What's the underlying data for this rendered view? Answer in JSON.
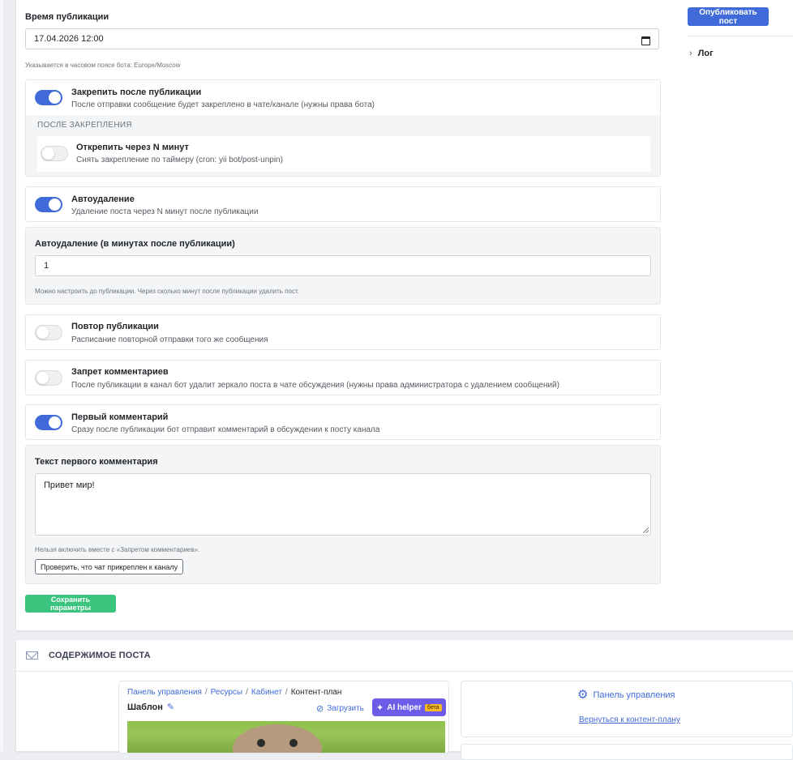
{
  "sidebar": {
    "publish_label": "Опубликовать пост",
    "log_label": "Лог"
  },
  "schedule": {
    "label": "Время публикации",
    "datetime_value": "17.04.2026 12:00",
    "hint": "Указывается в часовом поясе бота: Europe/Moscow"
  },
  "pin": {
    "title": "Закрепить после публикации",
    "desc": "После отправки сообщение будет закреплено в чате/канале (нужны права бота)",
    "enabled": true,
    "after_label": "ПОСЛЕ ЗАКРЕПЛЕНИЯ",
    "unpin_title": "Открепить через N минут",
    "unpin_desc": "Снять закрепление по таймеру (cron: yii bot/post-unpin)",
    "unpin_enabled": false
  },
  "autodelete": {
    "title": "Автоудаление",
    "desc": "Удаление поста через N минут после публикации",
    "enabled": true,
    "minutes_label": "Автоудаление (в минутах после публикации)",
    "minutes_value": "1",
    "minutes_hint": "Можно настроить до публикации. Через сколько минут после публикации удалить пост."
  },
  "repeat": {
    "title": "Повтор публикации",
    "desc": "Расписание повторной отправки того же сообщения",
    "enabled": false
  },
  "no_comments": {
    "title": "Запрет комментариев",
    "desc": "После публикации в канал бот удалит зеркало поста в чате обсуждения (нужны права администратора с удалением сообщений)",
    "enabled": false
  },
  "first_comment": {
    "title": "Первый комментарий",
    "desc": "Сразу после публикации бот отправит комментарий в обсуждении к посту канала",
    "enabled": true,
    "text_label": "Текст первого комментария",
    "text_value": "Привет мир!",
    "hint": "Нельзя включить вместе с «Запретом комментариев».",
    "check_label": "Проверить, что чат прикреплен к каналу"
  },
  "save_label": "Сохранить параметры",
  "content": {
    "header": "СОДЕРЖИМОЕ ПОСТА",
    "breadcrumbs": [
      "Панель управления",
      "Ресурсы",
      "Кабинет",
      "Контент-план"
    ],
    "template_label": "Шаблон",
    "upload_label": "Загрузить",
    "ai_label": "AI helper",
    "beta_label": "бета",
    "panel_title": "Панель управления",
    "panel_link": "Вернуться к контент-плану"
  },
  "colors": {
    "primary": "#3f6ad8",
    "success": "#3ac47d",
    "ai": "#6d5ce7",
    "beta": "#f7b924"
  }
}
